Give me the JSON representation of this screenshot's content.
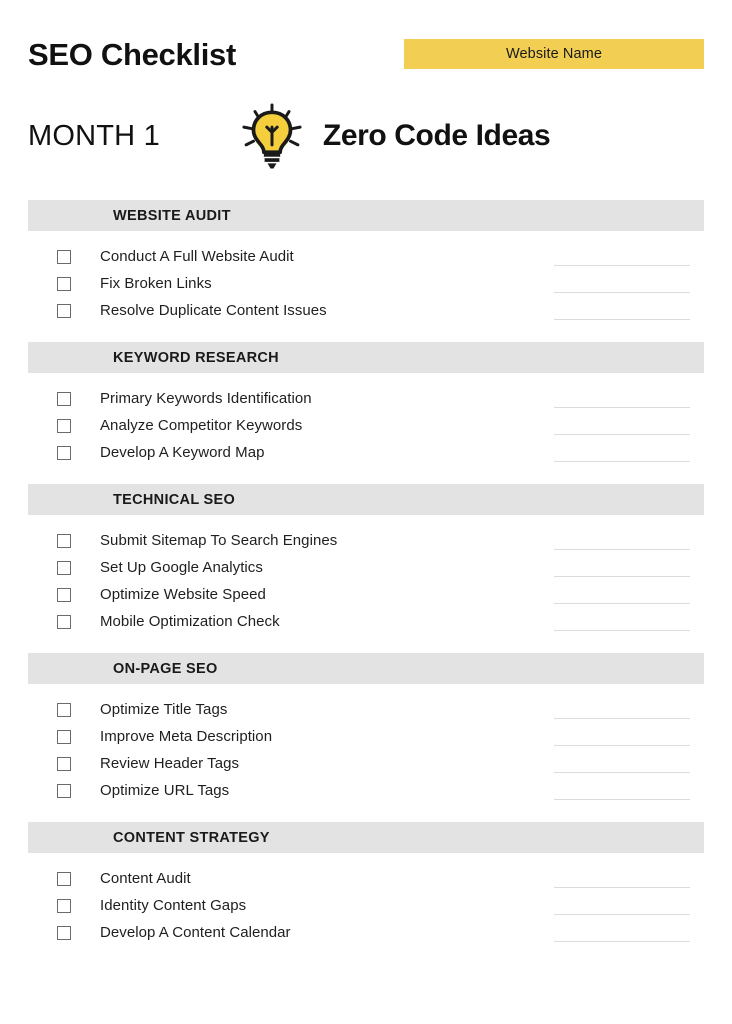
{
  "header": {
    "doc_title": "SEO Checklist",
    "month_label": "MONTH 1",
    "website_name_banner": "Website Name",
    "brand_name": "Zero Code Ideas",
    "logo_icon": "lightbulb-icon",
    "banner_color": "#F2CF52"
  },
  "theme": {
    "accent_yellow": "#F2CF52",
    "section_bar_gray": "#E3E3E3",
    "text_color": "#1a1a1a",
    "line_color": "#dcdcdc",
    "page_background": "#ffffff"
  },
  "sections": [
    {
      "title": "WEBSITE AUDIT",
      "items": [
        {
          "label": "Conduct A Full Website Audit",
          "checked": false
        },
        {
          "label": "Fix Broken Links",
          "checked": false
        },
        {
          "label": "Resolve Duplicate Content Issues",
          "checked": false
        }
      ]
    },
    {
      "title": "KEYWORD RESEARCH",
      "items": [
        {
          "label": "Primary Keywords Identification",
          "checked": false
        },
        {
          "label": "Analyze Competitor Keywords",
          "checked": false
        },
        {
          "label": "Develop A Keyword Map",
          "checked": false
        }
      ]
    },
    {
      "title": "TECHNICAL SEO",
      "items": [
        {
          "label": "Submit Sitemap To Search Engines",
          "checked": false
        },
        {
          "label": "Set Up Google Analytics",
          "checked": false
        },
        {
          "label": "Optimize Website Speed",
          "checked": false
        },
        {
          "label": "Mobile Optimization Check",
          "checked": false
        }
      ]
    },
    {
      "title": "ON-PAGE SEO",
      "items": [
        {
          "label": "Optimize Title Tags",
          "checked": false
        },
        {
          "label": "Improve Meta Description",
          "checked": false
        },
        {
          "label": "Review Header Tags",
          "checked": false
        },
        {
          "label": "Optimize URL Tags",
          "checked": false
        }
      ]
    },
    {
      "title": "CONTENT STRATEGY",
      "items": [
        {
          "label": "Content Audit",
          "checked": false
        },
        {
          "label": "Identity Content Gaps",
          "checked": false
        },
        {
          "label": "Develop A Content Calendar",
          "checked": false
        }
      ]
    }
  ]
}
